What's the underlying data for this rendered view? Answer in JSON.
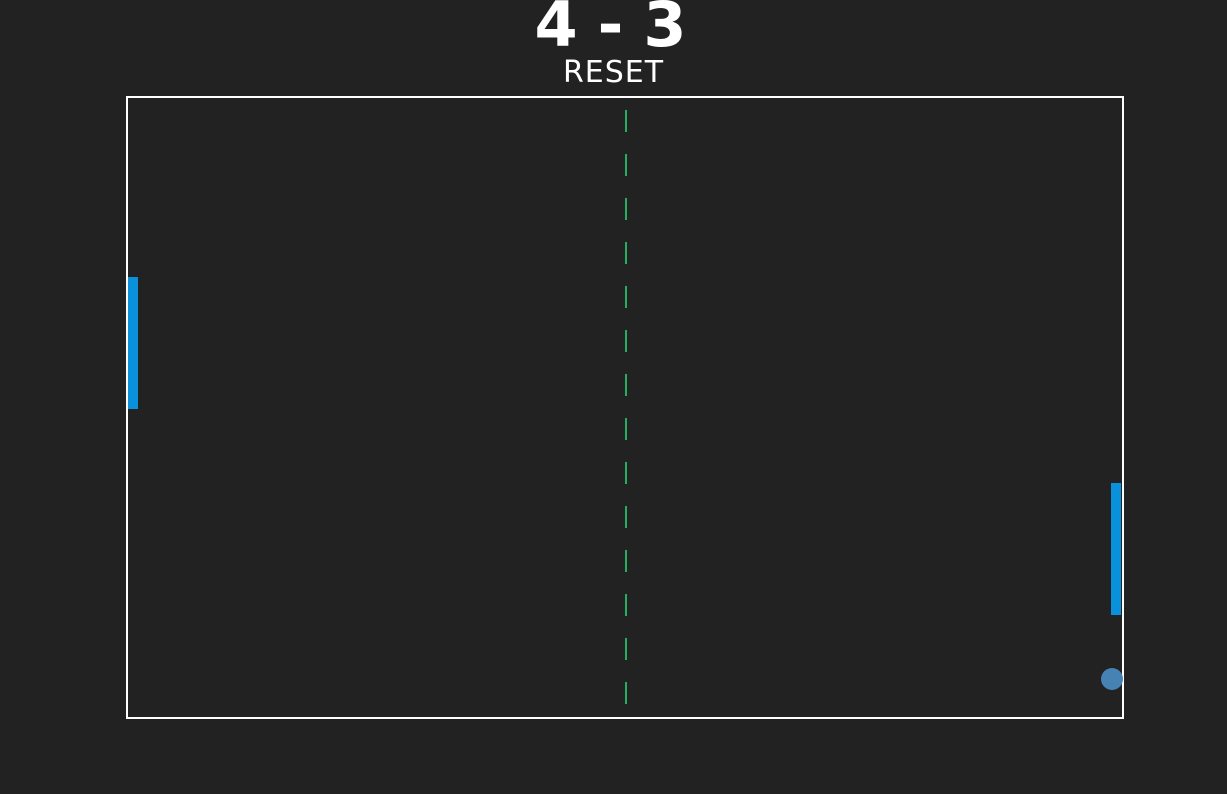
{
  "score": {
    "left": "4",
    "separator": "-",
    "right": "3"
  },
  "reset_label": "RESET",
  "colors": {
    "background": "#222222",
    "court_border": "#ffffff",
    "midline": "#27ae60",
    "paddle": "#0a91db",
    "ball": "#4682b4",
    "text": "#ffffff"
  },
  "icons": {
    "ball": "circle-ball-icon"
  }
}
